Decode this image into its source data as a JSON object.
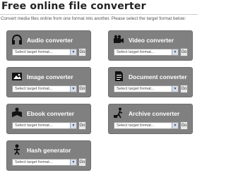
{
  "header": {
    "title": "Free online file converter",
    "subtitle": "Convert media files online from one format into another. Please select the target format below:"
  },
  "converters": [
    {
      "label": "Audio converter",
      "icon": "headphones-icon",
      "placeholder": "Select target format...",
      "go": "Go"
    },
    {
      "label": "Video converter",
      "icon": "film-camera-icon",
      "placeholder": "Select target format...",
      "go": "Go"
    },
    {
      "label": "Image converter",
      "icon": "photo-icon",
      "placeholder": "Select target format...",
      "go": "Go"
    },
    {
      "label": "Document converter",
      "icon": "document-icon",
      "placeholder": "Select target format...",
      "go": "Go"
    },
    {
      "label": "Ebook converter",
      "icon": "ebook-icon",
      "placeholder": "Select target format...",
      "go": "Go"
    },
    {
      "label": "Archive converter",
      "icon": "archive-icon",
      "placeholder": "Select target format...",
      "go": "Go"
    },
    {
      "label": "Hash generator",
      "icon": "hash-person-icon",
      "placeholder": "Select target format...",
      "go": "Go"
    }
  ]
}
